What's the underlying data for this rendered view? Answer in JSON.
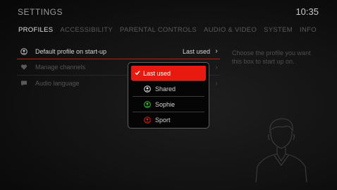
{
  "header": {
    "title": "SETTINGS",
    "clock": "10:35"
  },
  "tabs": [
    {
      "label": "PROFILES",
      "active": true
    },
    {
      "label": "ACCESSIBILITY",
      "active": false
    },
    {
      "label": "PARENTAL CONTROLS",
      "active": false
    },
    {
      "label": "AUDIO & VIDEO",
      "active": false
    },
    {
      "label": "SYSTEM",
      "active": false
    },
    {
      "label": "INFO",
      "active": false
    }
  ],
  "settings": [
    {
      "icon": "user-circle-icon",
      "label": "Default profile on start-up",
      "value": "Last used",
      "active": true
    },
    {
      "icon": "heart-icon",
      "label": "Manage channels",
      "value": "",
      "active": false
    },
    {
      "icon": "speech-bubble-icon",
      "label": "Audio language",
      "value": "",
      "active": false
    }
  ],
  "hint": "Choose the profile you want this box to start up on.",
  "dropdown": {
    "options": [
      {
        "label": "Last used",
        "icon": "checkmark-icon",
        "selected": true
      },
      {
        "label": "Shared",
        "icon": "user-circle-icon",
        "color": "#e6e6e6",
        "selected": false
      },
      {
        "label": "Sophie",
        "icon": "user-circle-icon",
        "color": "#3ec23e",
        "selected": false
      },
      {
        "label": "Sport",
        "icon": "user-circle-icon",
        "color": "#e8190e",
        "selected": false
      }
    ]
  },
  "colors": {
    "accent": "#e8190e",
    "background": "#121212",
    "text": "#d8d8d8",
    "muted": "#555555"
  }
}
